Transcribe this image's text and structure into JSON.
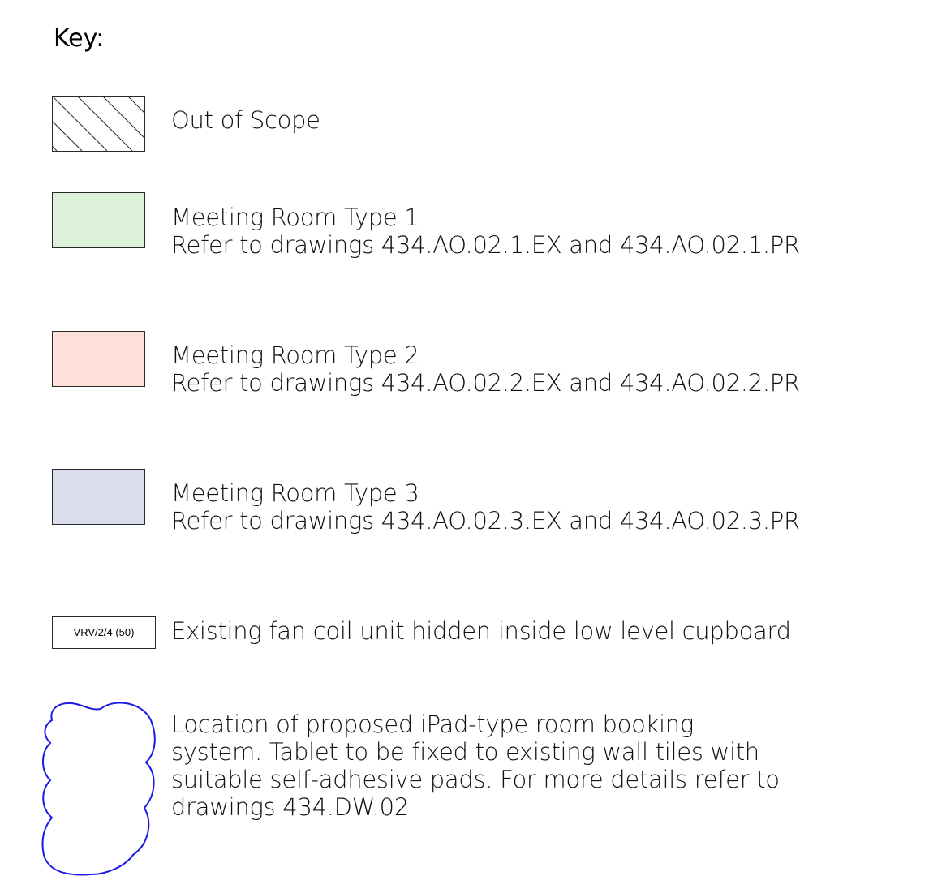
{
  "key": {
    "title": "Key:",
    "items": [
      {
        "symbol": "hatch",
        "lines": [
          "Out of Scope"
        ]
      },
      {
        "symbol": "fill",
        "fill_color": "#dcf0da",
        "lines": [
          "Meeting Room Type 1",
          "Refer to drawings 434.AO.02.1.EX and 434.AO.02.1.PR"
        ]
      },
      {
        "symbol": "fill",
        "fill_color": "#fde0d9",
        "lines": [
          "Meeting Room Type 2",
          "Refer to drawings 434.AO.02.2.EX and 434.AO.02.2.PR"
        ]
      },
      {
        "symbol": "fill",
        "fill_color": "#d9ddec",
        "lines": [
          "Meeting Room Type 3",
          "Refer to drawings 434.AO.02.3.EX and 434.AO.02.3.PR"
        ]
      },
      {
        "symbol": "tag",
        "tag_text": "VRV/2/4 (50)",
        "lines": [
          "Existing fan coil unit hidden inside low level cupboard"
        ]
      },
      {
        "symbol": "revision-cloud",
        "stroke_color": "#1a1ae6",
        "lines": [
          "Location of proposed iPad-type room booking",
          "system. Tablet to be fixed to existing wall tiles with",
          "suitable self-adhesive pads. For more details refer to",
          "drawings 434.DW.02"
        ]
      }
    ]
  }
}
